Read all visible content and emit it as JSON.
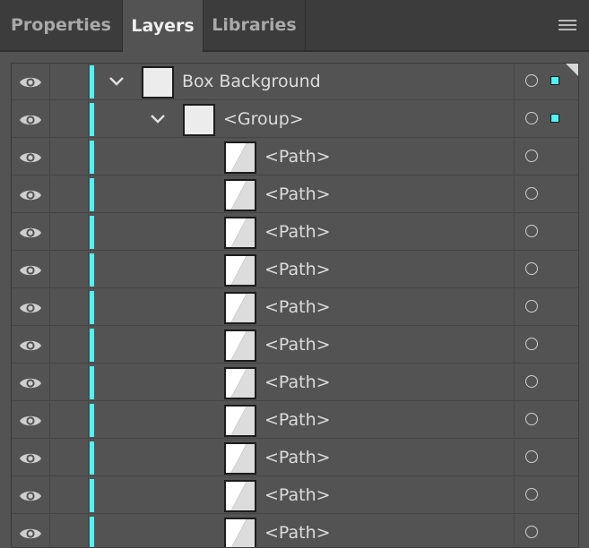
{
  "tabs": [
    {
      "label": "Properties",
      "active": false
    },
    {
      "label": "Layers",
      "active": true
    },
    {
      "label": "Libraries",
      "active": false
    }
  ],
  "panel_menu_icon": "hamburger-menu-icon",
  "layer_color": "#4ef3f6",
  "layers": [
    {
      "name": "Box Background",
      "level": 0,
      "expanded": true,
      "has_selection": true,
      "thumb": "solid"
    },
    {
      "name": "<Group>",
      "level": 1,
      "expanded": true,
      "has_selection": true,
      "thumb": "solid"
    },
    {
      "name": "<Path>",
      "level": 2,
      "thumb": "path"
    },
    {
      "name": "<Path>",
      "level": 2,
      "thumb": "path"
    },
    {
      "name": "<Path>",
      "level": 2,
      "thumb": "path"
    },
    {
      "name": "<Path>",
      "level": 2,
      "thumb": "path"
    },
    {
      "name": "<Path>",
      "level": 2,
      "thumb": "path"
    },
    {
      "name": "<Path>",
      "level": 2,
      "thumb": "path"
    },
    {
      "name": "<Path>",
      "level": 2,
      "thumb": "path"
    },
    {
      "name": "<Path>",
      "level": 2,
      "thumb": "path"
    },
    {
      "name": "<Path>",
      "level": 2,
      "thumb": "path"
    },
    {
      "name": "<Path>",
      "level": 2,
      "thumb": "path"
    },
    {
      "name": "<Path>",
      "level": 2,
      "thumb": "path"
    }
  ]
}
